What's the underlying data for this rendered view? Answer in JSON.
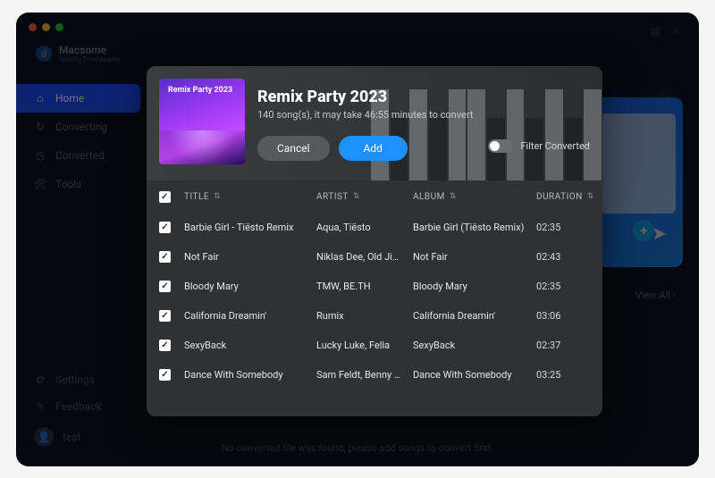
{
  "brand": {
    "title": "Macsome",
    "subtitle": "Spotify Downloader"
  },
  "sidebar": {
    "items": [
      {
        "label": "Home",
        "icon": "home-icon"
      },
      {
        "label": "Converting",
        "icon": "converting-icon"
      },
      {
        "label": "Converted",
        "icon": "converted-icon"
      },
      {
        "label": "Tools",
        "icon": "tools-icon"
      }
    ],
    "bottom": [
      {
        "label": "Settings",
        "icon": "settings-icon"
      },
      {
        "label": "Feedback",
        "icon": "feedback-icon"
      },
      {
        "label": "test",
        "icon": "user-icon"
      }
    ]
  },
  "background": {
    "view_all": "View All",
    "empty_message": "No converted file was found, please add songs to convert first."
  },
  "modal": {
    "cover_text": "Remix Party 2023",
    "title": "Remix Party 2023",
    "subtitle": "140 song(s), it may take 46:55 minutes to convert",
    "cancel": "Cancel",
    "add": "Add",
    "filter_label": "Filter Converted",
    "columns": {
      "title": "TITLE",
      "artist": "ARTIST",
      "album": "ALBUM",
      "duration": "DURATION"
    },
    "tracks": [
      {
        "title": "Barbie Girl - Tiësto Remix",
        "artist": "Aqua, Tiësto",
        "album": "Barbie Girl (Tiësto Remix)",
        "duration": "02:35"
      },
      {
        "title": "Not Fair",
        "artist": "Niklas Dee, Old Ji…",
        "album": "Not Fair",
        "duration": "02:43"
      },
      {
        "title": "Bloody Mary",
        "artist": "TMW, BE.TH",
        "album": "Bloody Mary",
        "duration": "02:35"
      },
      {
        "title": "California Dreamin'",
        "artist": "Rumix",
        "album": "California Dreamin'",
        "duration": "03:06"
      },
      {
        "title": "SexyBack",
        "artist": "Lucky Luke, Fella",
        "album": "SexyBack",
        "duration": "02:37"
      },
      {
        "title": "Dance With Somebody",
        "artist": "Sam Feldt, Benny …",
        "album": "Dance With Somebody",
        "duration": "03:25"
      }
    ]
  }
}
